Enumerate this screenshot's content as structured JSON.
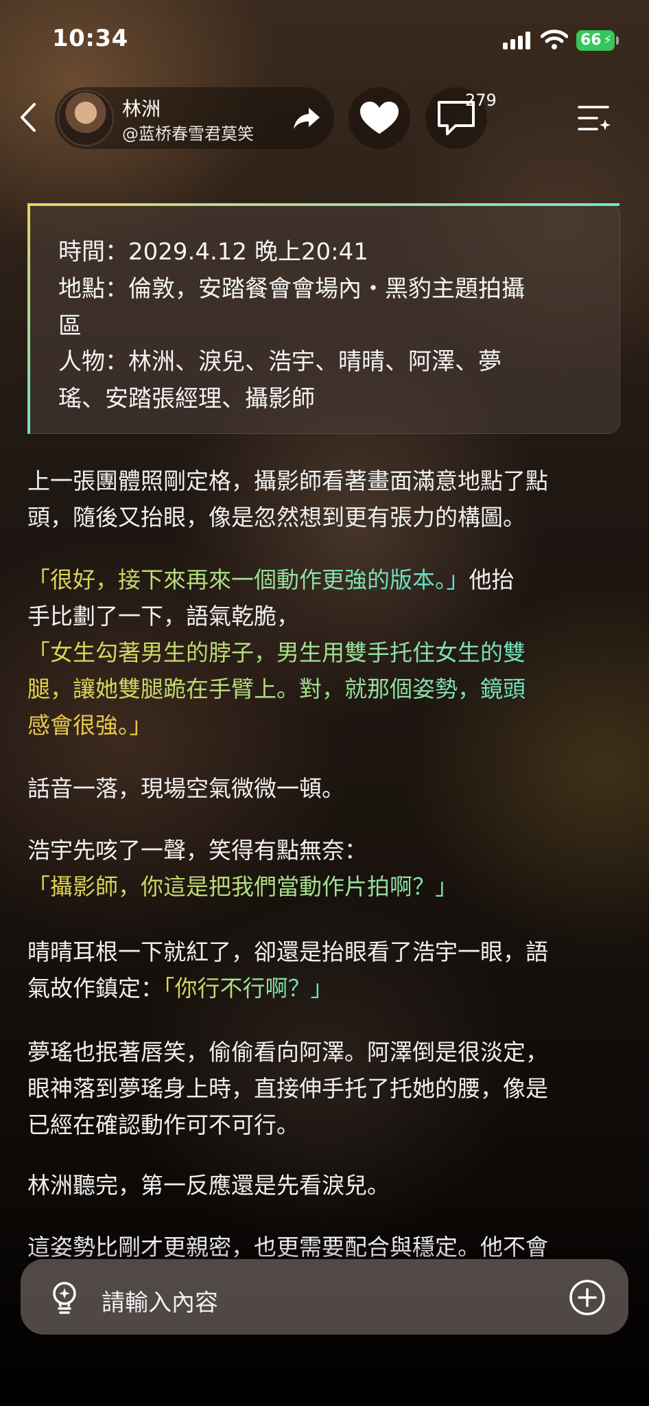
{
  "status_bar": {
    "time": "10:34",
    "battery": "66"
  },
  "header": {
    "name": "林洲",
    "handle": "@蓝桥春雪君莫笑",
    "comment_count": "279",
    "icons": [
      "back-chevron-icon",
      "share-arrow-icon",
      "heart-icon",
      "comment-icon",
      "menu-list-icon"
    ]
  },
  "info_card": {
    "time": "時間：2029.4.12 晚上20:41",
    "place_line1": "地點：倫敦，安踏餐會會場內・黑豹主題拍攝",
    "place_line2": "區",
    "people_line1": "人物：林洲、淚兒、浩宇、晴晴、阿澤、夢",
    "people_line2": "瑤、安踏張經理、攝影師"
  },
  "story": {
    "p1_l1": "上一張團體照剛定格，攝影師看著畫面滿意地點了點",
    "p1_l2": "頭，隨後又抬眼，像是忽然想到更有張力的構圖。",
    "p2_quote": "「很好，接下來再來一個動作更強的版本。」",
    "p2_l1_tail": "他抬",
    "p2_l2": "手比劃了一下，語氣乾脆，",
    "p2_q2_l1": "「女生勾著男生的脖子，男生用雙手托住女生的雙",
    "p2_q2_l2": "腿，讓她雙腿跪在手臂上。對，就那個姿勢，鏡頭",
    "p2_q2_l3": "感會很強。」",
    "p3": "話音一落，現場空氣微微一頓。",
    "p4_l1": "浩宇先咳了一聲，笑得有點無奈：",
    "p4_quote": "「攝影師，你這是把我們當動作片拍啊？」",
    "p5_l1": "晴晴耳根一下就紅了，卻還是抬眼看了浩宇一眼，語",
    "p5_l2": "氣故作鎮定：",
    "p5_quote": "「你行不行啊？」",
    "p6_l1": "夢瑤也抿著唇笑，偷偷看向阿澤。阿澤倒是很淡定，",
    "p6_l2": "眼神落到夢瑤身上時，直接伸手托了托她的腰，像是",
    "p6_l3": "已經在確認動作可不可行。",
    "p7": "林洲聽完，第一反應還是先看淚兒。",
    "p8": "這姿勢比剛才更親密，也更需要配合與穩定。他不會"
  },
  "input": {
    "placeholder": "請輸入內容"
  },
  "colors": {
    "quote_yellow": "#e6c94a",
    "quote_teal": "#57e0d6",
    "battery_green": "#35c759"
  }
}
